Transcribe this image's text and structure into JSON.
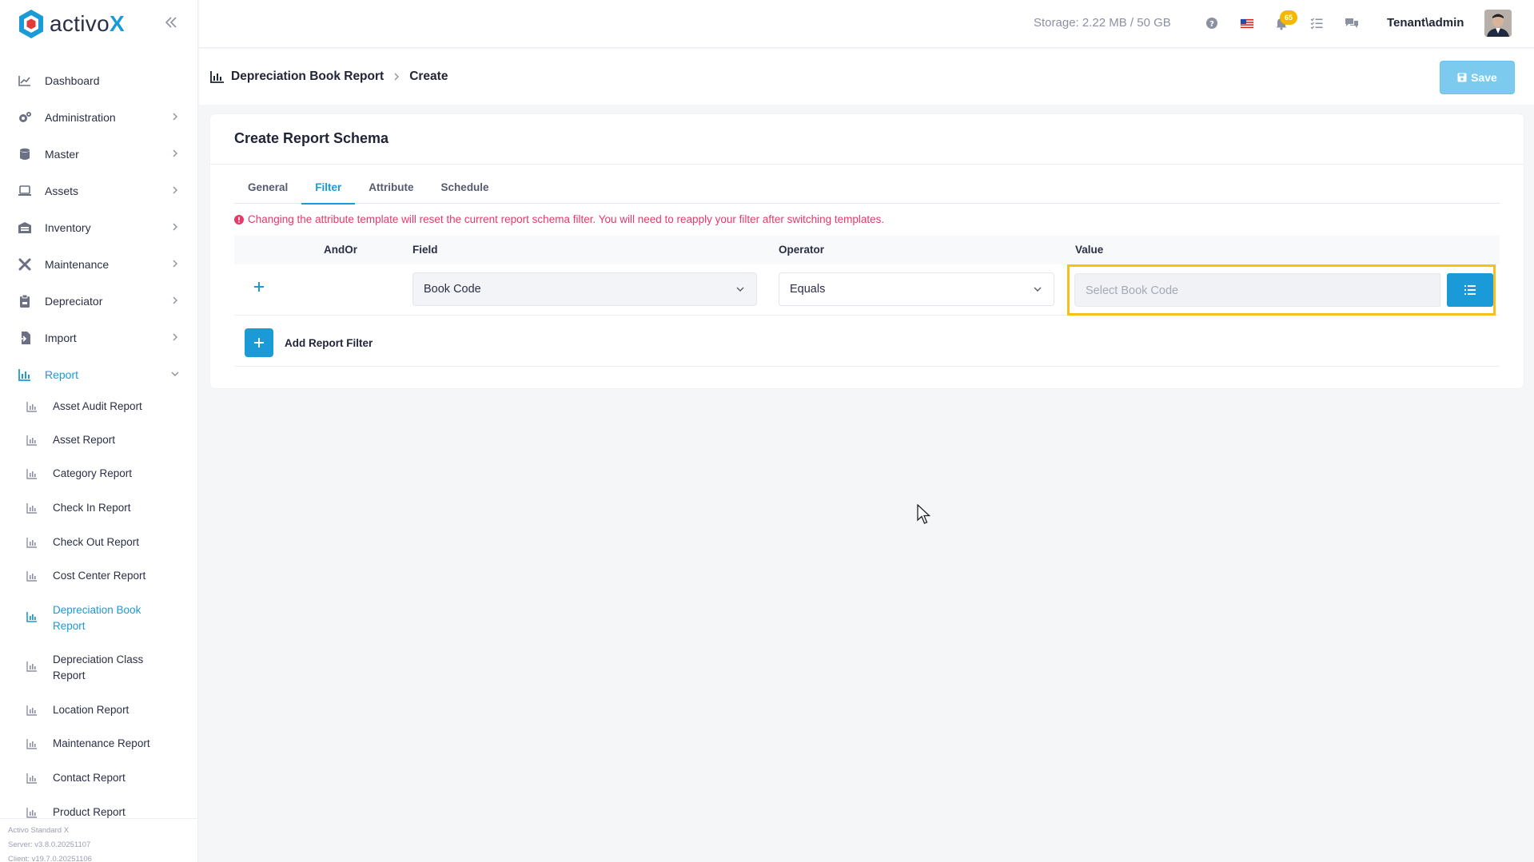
{
  "app": {
    "logo_text": "activo",
    "logo_x": "X"
  },
  "sidebar": {
    "items": [
      {
        "label": "Dashboard",
        "icon": "chart-line-icon",
        "has_chevron": false
      },
      {
        "label": "Administration",
        "icon": "cogs-icon",
        "has_chevron": true
      },
      {
        "label": "Master",
        "icon": "database-icon",
        "has_chevron": true
      },
      {
        "label": "Assets",
        "icon": "laptop-icon",
        "has_chevron": true
      },
      {
        "label": "Inventory",
        "icon": "warehouse-icon",
        "has_chevron": true
      },
      {
        "label": "Maintenance",
        "icon": "tools-icon",
        "has_chevron": true
      },
      {
        "label": "Depreciator",
        "icon": "clipboard-icon",
        "has_chevron": true
      },
      {
        "label": "Import",
        "icon": "file-import-icon",
        "has_chevron": true
      },
      {
        "label": "Report",
        "icon": "chart-bar-icon",
        "has_chevron": true,
        "active": true
      }
    ],
    "report_sub": [
      {
        "label": "Asset Audit Report"
      },
      {
        "label": "Asset Report"
      },
      {
        "label": "Category Report"
      },
      {
        "label": "Check In Report"
      },
      {
        "label": "Check Out Report"
      },
      {
        "label": "Cost Center Report"
      },
      {
        "label": "Depreciation Book Report",
        "active": true
      },
      {
        "label": "Depreciation Class Report"
      },
      {
        "label": "Location Report"
      },
      {
        "label": "Maintenance Report"
      },
      {
        "label": "Contact Report"
      },
      {
        "label": "Product Report"
      }
    ],
    "footer": {
      "edition": "Activo Standard X",
      "server": "Server: v3.8.0.20251107",
      "client": "Client: v19.7.0.20251106"
    }
  },
  "header": {
    "storage": "Storage: 2.22 MB / 50 GB",
    "notification_count": "65",
    "username": "Tenant\\admin"
  },
  "breadcrumb": {
    "parent": "Depreciation Book Report",
    "current": "Create"
  },
  "toolbar": {
    "save_label": "Save"
  },
  "card": {
    "title": "Create Report Schema",
    "tabs": [
      {
        "label": "General"
      },
      {
        "label": "Filter",
        "active": true
      },
      {
        "label": "Attribute"
      },
      {
        "label": "Schedule"
      }
    ],
    "warning": "Changing the attribute template will reset the current report schema filter. You will need to reapply your filter after switching templates.",
    "table": {
      "headers": {
        "andor": "AndOr",
        "field": "Field",
        "operator": "Operator",
        "value": "Value"
      },
      "row": {
        "field": "Book Code",
        "operator": "Equals",
        "value_placeholder": "Select Book Code"
      }
    },
    "add_filter_label": "Add Report Filter"
  },
  "colors": {
    "accent": "#1a9bd7",
    "warning_text": "#e6396a",
    "highlight": "#f6c019",
    "badge": "#f5b800"
  }
}
